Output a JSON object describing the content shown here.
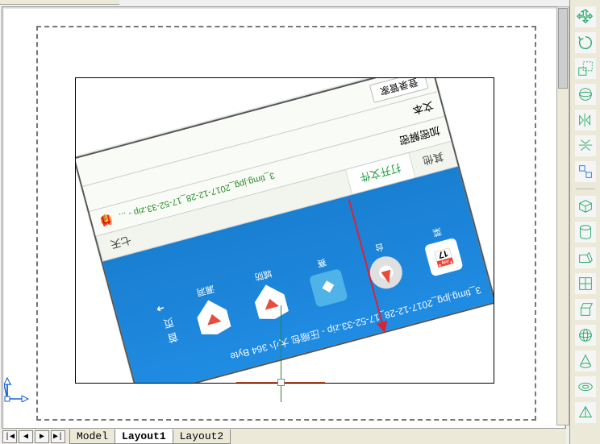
{
  "tabs": {
    "nav_first": "|◀",
    "nav_prev": "◀",
    "nav_next": "▶",
    "nav_last": "▶|",
    "model": "Model",
    "layout1": "Layout1",
    "layout2": "Layout2"
  },
  "embedded": {
    "title_line": "3_timg.jpg_2017-12-28_17-52-33.zip - 压缩包 大小 364 Byte",
    "status_line": "3_timg.jpg_2017-12-28_17-52-33.zip - ...",
    "row_label_1": "登录管家",
    "row_label_2": "文本",
    "row_label_3": "加密解密",
    "tab_active": "打开文件",
    "tab_other": "其他",
    "side_label": "七天",
    "side_label2": "首页",
    "apps": [
      {
        "label": "菜"
      },
      {
        "label": "台"
      },
      {
        "label": "赛"
      },
      {
        "label": "城防"
      },
      {
        "label": "漏洞"
      }
    ]
  },
  "toolbar_icons": [
    "move-icon",
    "rotate-icon",
    "scale-icon",
    "mirror-icon",
    "orbit-icon",
    "flip-h-icon",
    "flip-v-icon",
    "align-icon",
    "pan-icon",
    "box-icon",
    "cylinder-icon",
    "sphere-icon",
    "region-icon",
    "extrude-icon",
    "revolve-icon",
    "wedge-icon",
    "torus-icon",
    "cone-icon"
  ]
}
